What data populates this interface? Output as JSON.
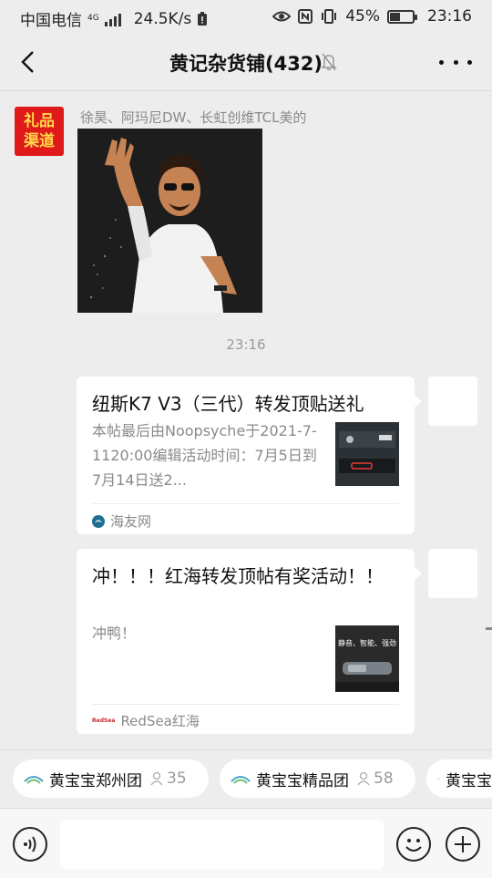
{
  "status_bar": {
    "carrier": "中国电信",
    "network_type": "4G",
    "speed": "24.5K/s",
    "battery_percent": "45%",
    "battery_level": 0.45,
    "time": "23:16"
  },
  "header": {
    "title": "黄记杂货铺(432)",
    "muted": true
  },
  "messages": {
    "first": {
      "avatar_text": "礼品渠道",
      "sender": "徐昊、阿玛尼DW、长虹创维TCL美的"
    },
    "timestamp": "23:16",
    "card1": {
      "title": "纽斯K7 V3（三代）转发顶贴送礼",
      "description": "本帖最后由Noopsyche于2021-7-1120:00编辑活动时间：7月5日到7月14日送2...",
      "source": "海友网"
    },
    "card2": {
      "title": "冲！！！红海转发顶帖有奖活动！！",
      "description": "冲鸭！",
      "thumb_text": "静音、智能、强劲",
      "source": "RedSea红海",
      "source_logo_text": "RedSea"
    }
  },
  "groups": [
    {
      "name": "黄宝宝郑州团",
      "count": "35"
    },
    {
      "name": "黄宝宝精品团",
      "count": "58"
    },
    {
      "name": "黄宝宝",
      "count": ""
    }
  ],
  "input": {
    "value": "",
    "placeholder": ""
  },
  "colors": {
    "background": "#ededed",
    "card": "#ffffff",
    "avatar_red": "#e01a1a",
    "secondary_text": "#8a8a8a"
  }
}
